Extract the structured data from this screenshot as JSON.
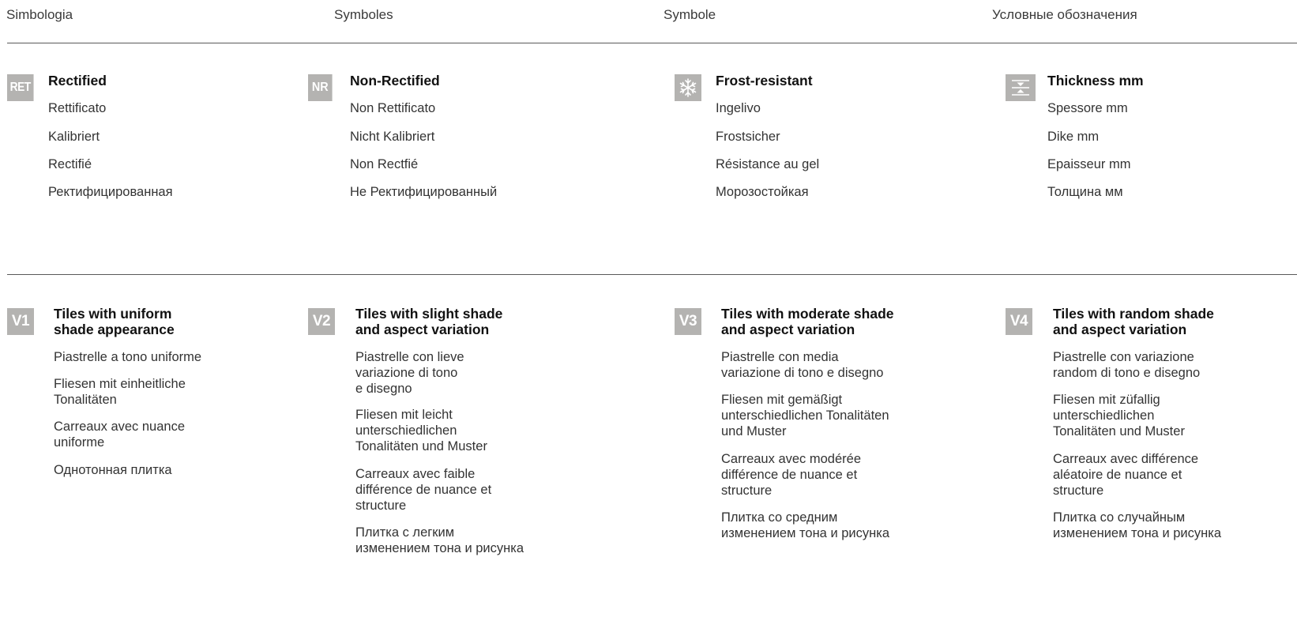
{
  "header": {
    "labels": [
      "Simbologia",
      "Symboles",
      "Symbole",
      "Условные обозначения"
    ]
  },
  "symbols": [
    {
      "badge": "RET",
      "title": "Rectified",
      "items": [
        "Rettificato",
        "Kalibriert",
        "Rectifié",
        "Ректифицированная"
      ]
    },
    {
      "badge": "NR",
      "title": "Non-Rectified",
      "items": [
        "Non Rettificato",
        "Nicht Kalibriert",
        "Non Rectfié",
        "Не Ректифицированный"
      ]
    },
    {
      "badge_icon": "snowflake-icon",
      "title": "Frost-resistant",
      "items": [
        "Ingelivo",
        "Frostsicher",
        "Résistance au gel",
        "Морозостойкая"
      ]
    },
    {
      "badge_icon": "thickness-icon",
      "title": "Thickness mm",
      "items": [
        "Spessore mm",
        "Dike mm",
        "Epaisseur mm",
        "Толщина мм"
      ]
    }
  ],
  "variations": [
    {
      "badge": "V1",
      "title": "Tiles with uniform\nshade appearance",
      "items": [
        "Piastrelle a tono uniforme",
        "Fliesen mit einheitliche\nTonalitäten",
        "Carreaux avec nuance\nuniforme",
        "Однотонная плитка"
      ]
    },
    {
      "badge": "V2",
      "title": "Tiles with slight shade\nand aspect variation",
      "items": [
        "Piastrelle con lieve\nvariazione di tono\ne disegno",
        "Fliesen mit leicht\nunterschiedlichen\nTonalitäten und Muster",
        "Carreaux avec faible\ndifférence de nuance et\nstructure",
        "Плитка с легким\nизменением тона и рисунка"
      ]
    },
    {
      "badge": "V3",
      "title": "Tiles with moderate shade\nand aspect variation",
      "items": [
        "Piastrelle con media\nvariazione di tono e disegno",
        "Fliesen mit gemäßigt\nunterschiedlichen Tonalitäten\nund Muster",
        "Carreaux avec modérée\ndifférence de nuance et\nstructure",
        "Плитка со средним\nизменением тона и рисунка"
      ]
    },
    {
      "badge": "V4",
      "title": "Tiles with random shade\nand aspect variation",
      "items": [
        "Piastrelle con variazione\nrandom di tono e disegno",
        "Fliesen mit züfallig\nunterschiedlichen\nTonalitäten und Muster",
        "Carreaux avec différence\naléatoire de nuance et\nstructure",
        "Плитка со случайным\nизменением тона и рисунка"
      ]
    }
  ],
  "colors": {
    "badge": "#b4b3b1",
    "rule": "#5a5a5a"
  }
}
